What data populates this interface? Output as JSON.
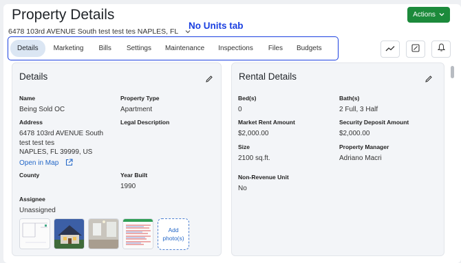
{
  "header": {
    "title": "Property Details",
    "actions_label": "Actions",
    "address": "6478 103rd AVENUE South test test tes NAPLES, FL",
    "annotation": "No Units tab"
  },
  "tabs": [
    {
      "label": "Details",
      "active": true
    },
    {
      "label": "Marketing"
    },
    {
      "label": "Bills"
    },
    {
      "label": "Settings"
    },
    {
      "label": "Maintenance"
    },
    {
      "label": "Inspections"
    },
    {
      "label": "Files"
    },
    {
      "label": "Budgets"
    }
  ],
  "toolbar_icons": [
    "chart-line-icon",
    "edit-square-icon",
    "bell-icon"
  ],
  "details": {
    "title": "Details",
    "name_label": "Name",
    "name_value": "Being Sold OC",
    "property_type_label": "Property Type",
    "property_type_value": "Apartment",
    "address_label": "Address",
    "address_line1": "6478 103rd AVENUE South",
    "address_line2": "test test tes",
    "address_line3": "NAPLES, FL 39999, US",
    "open_in_map": "Open in Map",
    "legal_description_label": "Legal Description",
    "county_label": "County",
    "year_built_label": "Year Built",
    "year_built_value": "1990",
    "assignee_label": "Assignee",
    "assignee_value": "Unassigned",
    "add_photo_label": "Add photo(s)"
  },
  "rental": {
    "title": "Rental Details",
    "beds_label": "Bed(s)",
    "beds_value": "0",
    "baths_label": "Bath(s)",
    "baths_value": "2 Full, 3 Half",
    "market_rent_label": "Market Rent Amount",
    "market_rent_value": "$2,000.00",
    "security_deposit_label": "Security Deposit Amount",
    "security_deposit_value": "$2,000.00",
    "size_label": "Size",
    "size_value": "2100 sq.ft.",
    "property_manager_label": "Property Manager",
    "property_manager_value": "Adriano Macri",
    "non_revenue_label": "Non-Revenue Unit",
    "non_revenue_value": "No"
  },
  "colors": {
    "accent": "#1c8a3b",
    "annotation": "#1a3fe0",
    "link": "#2367c7",
    "active_tab": "#dbe6f3"
  }
}
